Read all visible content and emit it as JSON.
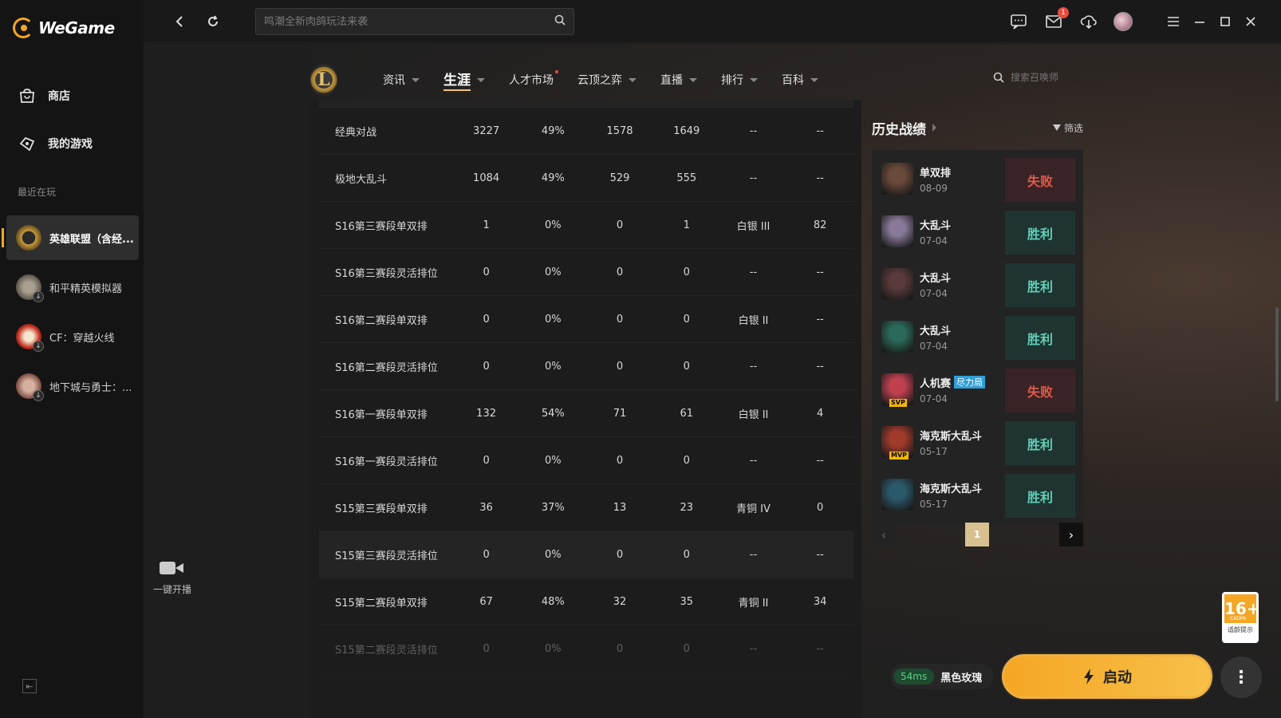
{
  "app": {
    "name": "WeGame"
  },
  "sidebar": {
    "store_label": "商店",
    "mygames_label": "我的游戏",
    "recent_label": "最近在玩",
    "games": [
      {
        "label": "英雄联盟（含经...",
        "active": true
      },
      {
        "label": "和平精英模拟器"
      },
      {
        "label": "CF：穿越火线"
      },
      {
        "label": "地下城与勇士：..."
      }
    ]
  },
  "topbar": {
    "search_placeholder": "鸣潮全新肉鸽玩法来袭",
    "mail_count": "1"
  },
  "lol_nav": {
    "tabs": [
      {
        "label": "资讯",
        "chevron": true
      },
      {
        "label": "生涯",
        "chevron": true,
        "active": true
      },
      {
        "label": "人才市场",
        "dot": true
      },
      {
        "label": "云顶之弈",
        "chevron": true
      },
      {
        "label": "直播",
        "chevron": true
      },
      {
        "label": "排行",
        "chevron": true
      },
      {
        "label": "百科",
        "chevron": true
      }
    ],
    "summoner_search_placeholder": "搜索召唤师"
  },
  "broadcast_label": "一键开播",
  "stats_table": {
    "rows": [
      [
        "经典对战",
        "3227",
        "49%",
        "1578",
        "1649",
        "--",
        "--"
      ],
      [
        "极地大乱斗",
        "1084",
        "49%",
        "529",
        "555",
        "--",
        "--"
      ],
      [
        "S16第三赛段单双排",
        "1",
        "0%",
        "0",
        "1",
        "白银 III",
        "82"
      ],
      [
        "S16第三赛段灵活排位",
        "0",
        "0%",
        "0",
        "0",
        "--",
        "--"
      ],
      [
        "S16第二赛段单双排",
        "0",
        "0%",
        "0",
        "0",
        "白银 II",
        "--"
      ],
      [
        "S16第二赛段灵活排位",
        "0",
        "0%",
        "0",
        "0",
        "--",
        "--"
      ],
      [
        "S16第一赛段单双排",
        "132",
        "54%",
        "71",
        "61",
        "白银 II",
        "4"
      ],
      [
        "S16第一赛段灵活排位",
        "0",
        "0%",
        "0",
        "0",
        "--",
        "--"
      ],
      [
        "S15第三赛段单双排",
        "36",
        "37%",
        "13",
        "23",
        "青铜 IV",
        "0"
      ],
      [
        "S15第三赛段灵活排位",
        "0",
        "0%",
        "0",
        "0",
        "--",
        "--"
      ],
      [
        "S15第二赛段单双排",
        "67",
        "48%",
        "32",
        "35",
        "青铜 II",
        "34"
      ],
      [
        "S15第二赛段灵活排位",
        "0",
        "0%",
        "0",
        "0",
        "--",
        "--"
      ]
    ]
  },
  "history": {
    "title": "历史战绩",
    "filter_label": "筛选",
    "matches": [
      {
        "mode": "单双排",
        "date": "08-09",
        "result": "失败",
        "win": false,
        "color": "#6a4a3a"
      },
      {
        "mode": "大乱斗",
        "date": "07-04",
        "result": "胜利",
        "win": true,
        "color": "#8a7a9a"
      },
      {
        "mode": "大乱斗",
        "date": "07-04",
        "result": "胜利",
        "win": true,
        "color": "#5a3a3a"
      },
      {
        "mode": "大乱斗",
        "date": "07-04",
        "result": "胜利",
        "win": true,
        "color": "#2a6a5a"
      },
      {
        "mode": "人机赛",
        "badge": "尽力局",
        "tag": "SVP",
        "date": "07-04",
        "result": "失败",
        "win": false,
        "color": "#c04050"
      },
      {
        "mode": "海克斯大乱斗",
        "tag": "MVP",
        "date": "05-17",
        "result": "胜利",
        "win": true,
        "color": "#a03a2a"
      },
      {
        "mode": "海克斯大乱斗",
        "date": "05-17",
        "result": "胜利",
        "win": true,
        "color": "#2a5a6a"
      }
    ],
    "page": "1"
  },
  "age_rating": {
    "label": "16+",
    "org": "CADPA",
    "caption": "适龄提示"
  },
  "launch": {
    "ping": "54ms",
    "server": "黑色玫瑰",
    "button_label": "启动"
  }
}
